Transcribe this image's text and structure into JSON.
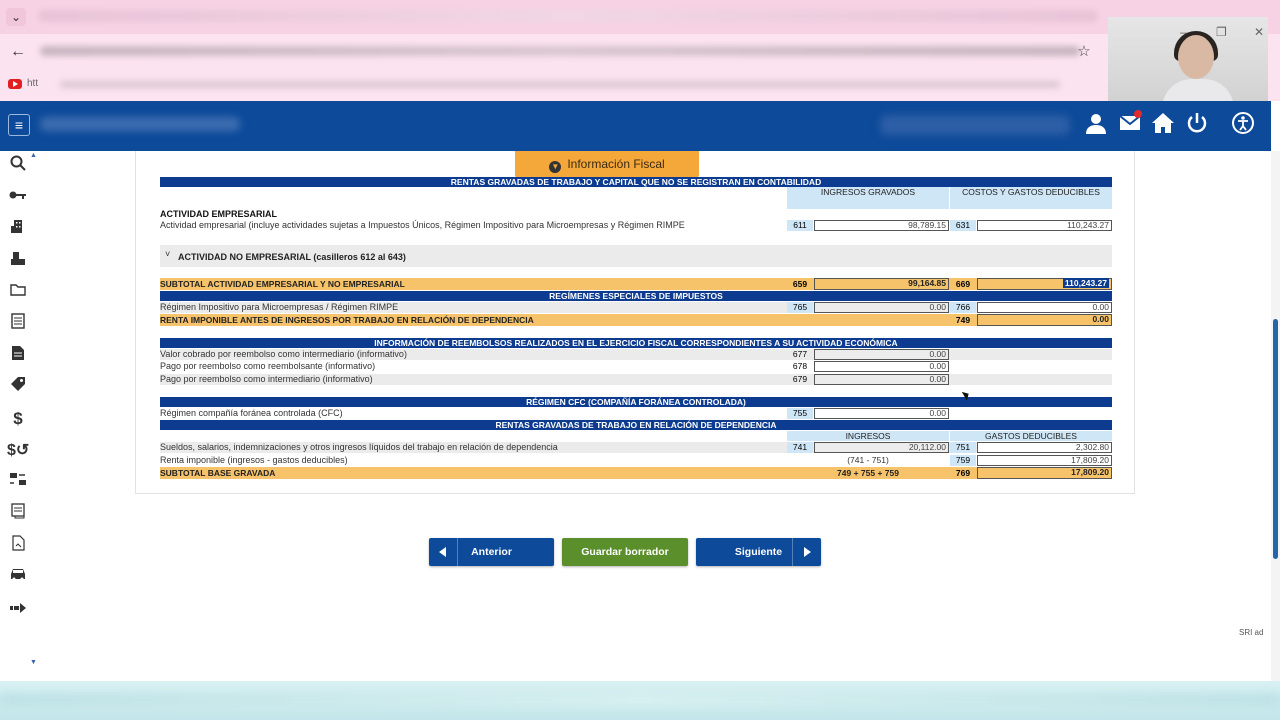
{
  "browser": {
    "bookmark_text": "htt"
  },
  "window_controls": {
    "minimize": "–",
    "maximize": "❐",
    "close": "✕"
  },
  "sidebar_icons": [
    "search-icon",
    "key-icon",
    "building-icon",
    "machine-icon",
    "folder-icon",
    "document-icon",
    "file-icon",
    "tag-icon",
    "dollar-icon",
    "refund-icon",
    "exchange-icon",
    "list-icon",
    "page-icon",
    "car-icon",
    "arrow-icon"
  ],
  "section": {
    "title": "Información Fiscal"
  },
  "table": {
    "h_rentas_sin_contab": "RENTAS GRAVADAS DE TRABAJO Y CAPITAL QUE NO SE REGISTRAN EN CONTABILIDAD",
    "col_ingresos_gravados": "INGRESOS GRAVADOS",
    "col_costos_gastos": "COSTOS Y GASTOS DEDUCIBLES",
    "actividad_empresarial_title": "ACTIVIDAD EMPRESARIAL",
    "actividad_empresarial_desc": "Actividad empresarial (incluye actividades sujetas a Impuestos Únicos, Régimen Impositivo para Microempresas y Régimen RIMPE",
    "code_611": "611",
    "val_611": "98,789.15",
    "code_631": "631",
    "val_631": "110,243.27",
    "actividad_no_empresarial": "ACTIVIDAD NO EMPRESARIAL (casilleros 612 al 643)",
    "subtotal_label": "SUBTOTAL ACTIVIDAD EMPRESARIAL Y NO EMPRESARIAL",
    "code_659": "659",
    "val_659": "99,164.85",
    "code_669": "669",
    "val_669": "110,243.27",
    "h_regimenes": "REGÍMENES ESPECIALES DE IMPUESTOS",
    "rimpe_label": "Régimen Impositivo para Microempresas / Régimen RIMPE",
    "code_765": "765",
    "val_765": "0.00",
    "code_766": "766",
    "val_766": "0.00",
    "renta_imponible_label": "RENTA IMPONIBLE ANTES DE INGRESOS POR TRABAJO EN RELACIÓN DE DEPENDENCIA",
    "code_749": "749",
    "val_749": "0.00",
    "h_reembolsos": "INFORMACIÓN DE REEMBOLSOS REALIZADOS EN EL EJERCICIO FISCAL CORRESPONDIENTES A SU ACTIVIDAD ECONÓMICA",
    "reembolso_1_label": "Valor cobrado por reembolso como intermediario (informativo)",
    "code_677": "677",
    "val_677": "0.00",
    "reembolso_2_label": "Pago por reembolso como reembolsante (informativo)",
    "code_678": "678",
    "val_678": "0.00",
    "reembolso_3_label": "Pago por reembolso como intermediario (informativo)",
    "code_679": "679",
    "val_679": "0.00",
    "h_cfc": "RÉGIMEN CFC (COMPAÑÍA FORÁNEA CONTROLADA)",
    "cfc_label": "Régimen compañía foránea controlada (CFC)",
    "code_755": "755",
    "val_755": "0.00",
    "h_dependencia": "RENTAS GRAVADAS DE TRABAJO EN RELACIÓN DE DEPENDENCIA",
    "col_ingresos": "INGRESOS",
    "col_gastos_deducibles": "GASTOS DEDUCIBLES",
    "sueldos_label": "Sueldos, salarios, indemnizaciones y otros ingresos líquidos del trabajo en relación de dependencia",
    "code_741": "741",
    "val_741": "20,112.00",
    "code_751": "751",
    "val_751": "2,302.80",
    "renta_imp_label": "Renta imponible (ingresos - gastos deducibles)",
    "formula_741_751": "(741 - 751)",
    "code_759": "759",
    "val_759": "17,809.20",
    "subtotal_base_label": "SUBTOTAL BASE GRAVADA",
    "formula_base": "749 + 755 + 759",
    "code_769": "769",
    "val_769": "17,809.20"
  },
  "buttons": {
    "anterior": "Anterior",
    "guardar": "Guardar borrador",
    "siguiente": "Siguiente"
  },
  "footer": {
    "sri_ad": "SRI ad"
  }
}
